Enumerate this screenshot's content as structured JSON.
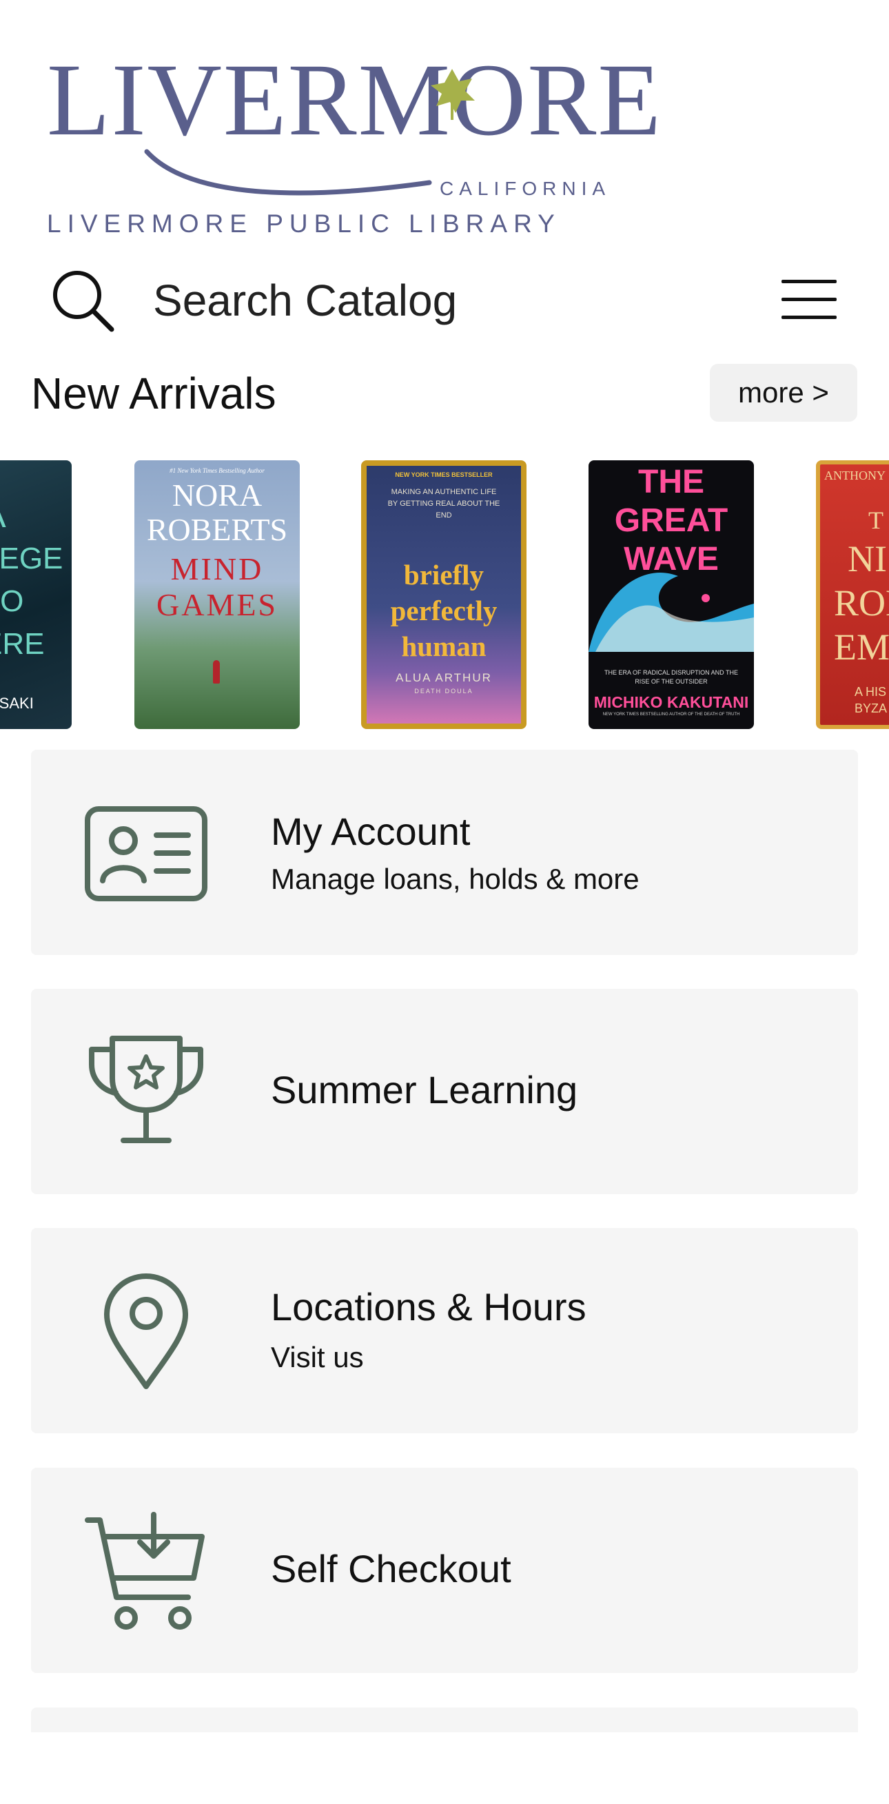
{
  "logo": {
    "wordmark": "LIVERMORE",
    "state": "CALIFORNIA",
    "name": "LIVERMORE PUBLIC LIBRARY"
  },
  "search": {
    "placeholder": "Search Catalog"
  },
  "new_arrivals": {
    "title": "New Arrivals",
    "more_label": "more >",
    "books": [
      {
        "lines": [
          "A",
          "LEGE",
          "TO",
          "ERE",
          "ASAKI"
        ]
      },
      {
        "header": "#1 New York Times Bestselling Author",
        "author": "NORA ROBERTS",
        "title": "MIND GAMES"
      },
      {
        "header": "NEW YORK TIMES BESTSELLER",
        "tagline": "MAKING AN AUTHENTIC LIFE BY GETTING REAL ABOUT THE END",
        "title": "briefly perfectly human",
        "author": "ALUA ARTHUR",
        "extra": "DEATH DOULA"
      },
      {
        "title": "THE GREAT WAVE",
        "tagline": "THE ERA OF RADICAL DISRUPTION AND THE RISE OF THE OUTSIDER",
        "author": "MICHIKO KAKUTANI",
        "footer": "NEW YORK TIMES BESTSELLING AUTHOR OF THE DEATH OF TRUTH"
      },
      {
        "lines": [
          "ANTHONY",
          "T",
          "NI",
          "ROM",
          "EM",
          "A HIS",
          "BYZA"
        ]
      }
    ]
  },
  "cards": [
    {
      "title": "My Account",
      "subtitle": "Manage loans, holds & more",
      "icon": "id-card-icon"
    },
    {
      "title": "Summer Learning",
      "subtitle": "",
      "icon": "trophy-icon"
    },
    {
      "title": "Locations & Hours",
      "subtitle": "Visit us",
      "icon": "map-pin-icon"
    },
    {
      "title": "Self Checkout",
      "subtitle": "",
      "icon": "cart-icon"
    }
  ],
  "colors": {
    "brand": "#5a5f8c",
    "leaf": "#a6b14a",
    "icon": "#556b5d",
    "card_bg": "#f5f5f5"
  }
}
